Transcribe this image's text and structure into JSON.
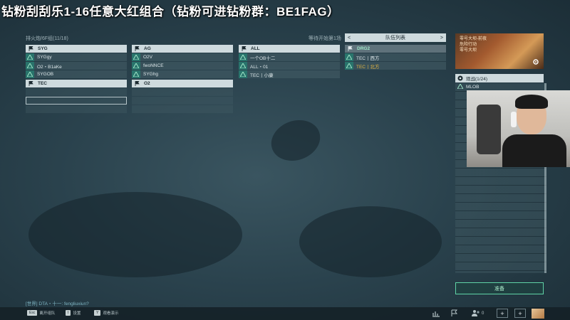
{
  "stream_title": "钻粉刮刮乐1-16任意大红组合（钻粉可进钻粉群：BE1FAG）",
  "server_label": "排火炮/6F组(11/18)",
  "wait_label": "等待开始第1场",
  "teams": [
    {
      "id": "syg",
      "name": "SYG",
      "players": [
        "SYGgy",
        "O2・B1aKe",
        "SYGOB"
      ]
    },
    {
      "id": "ag",
      "name": "AG",
      "players": [
        "O2V",
        "fwoNNCE",
        "SYGhg"
      ]
    },
    {
      "id": "all",
      "name": "ALL",
      "players": [
        "一个OB十二",
        "ALL・01",
        "TEC丨小康"
      ]
    },
    {
      "id": "drg2",
      "name": "DRG2",
      "players": [
        "TEC丨西方",
        "TEC丨北方"
      ]
    },
    {
      "id": "tec",
      "name": "TEC",
      "players": []
    },
    {
      "id": "o2",
      "name": "O2",
      "players": []
    }
  ],
  "team_list": {
    "label": "队伍列表",
    "prev": "<",
    "next": ">"
  },
  "preview": {
    "line1": "零号大坝-前夜",
    "line2": "危险行动",
    "line3": "零号大坝"
  },
  "spectator": {
    "label": "观战(1/24)",
    "players": [
      "MLOB"
    ]
  },
  "ready_label": "准备",
  "chat": "[世界] DTA・十一: fengliuxiun?",
  "bottom_hints": [
    {
      "key": "Esc",
      "label": "离开组队"
    },
    {
      "key": "I",
      "label": "设置"
    },
    {
      "key": "Y",
      "label": "观看演示"
    }
  ],
  "bottom_counts": {
    "online": "0"
  },
  "colors": {
    "accent": "#5fd3a6",
    "gold": "#e5b442",
    "header": "#e6f0f2"
  }
}
